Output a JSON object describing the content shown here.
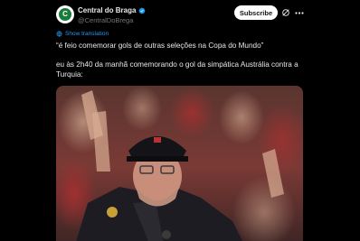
{
  "author": {
    "display_name": "Central do Braga",
    "handle": "@CentralDoBrega",
    "avatar_letter": "C",
    "verified": true,
    "avatar_color": "#1a7a3a"
  },
  "actions": {
    "subscribe_label": "Subscribe"
  },
  "translation": {
    "label": "Show translation"
  },
  "tweet": {
    "quote_line": "“é feio comemorar gols de outras seleções na Copa do Mundo”",
    "body_line": "eu às 2h40 da manhã comemorando o gol da simpática Austrália contra a Turquia:"
  },
  "media": {
    "type": "video-still",
    "description_icon": "video-thumbnail"
  },
  "colors": {
    "background": "#000000",
    "text": "#e7e9ea",
    "secondary": "#71767b",
    "link": "#1d9bf0",
    "verified": "#1d9bf0"
  }
}
